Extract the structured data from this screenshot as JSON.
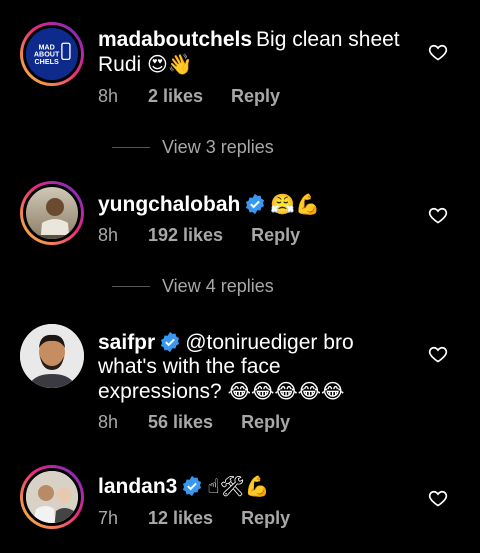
{
  "comments": [
    {
      "username": "madaboutchels",
      "verified": false,
      "mention": "",
      "text": "Big clean sheet Rudi",
      "emojis": "😍👋",
      "time": "8h",
      "likes": "2 likes",
      "reply": "Reply",
      "avatar_text": "MADABOUTCHELS"
    },
    {
      "username": "yungchalobah",
      "verified": true,
      "mention": "",
      "text": "",
      "emojis": "😤💪",
      "time": "8h",
      "likes": "192 likes",
      "reply": "Reply"
    },
    {
      "username": "saifpr",
      "verified": true,
      "mention": "@toniruediger",
      "text": "bro what's with the face expressions?",
      "emojis": "😂😂😂😂😂",
      "time": "8h",
      "likes": "56 likes",
      "reply": "Reply"
    },
    {
      "username": "landan3",
      "verified": true,
      "mention": "",
      "text": "",
      "emojis": "☝🛠💪",
      "time": "7h",
      "likes": "12 likes",
      "reply": "Reply"
    }
  ],
  "view_replies": [
    "View 3 replies",
    "View 4 replies"
  ],
  "colors": {
    "background": "#000000",
    "text": "#ffffff",
    "meta": "#a8a8a8",
    "verified": "#3897f0"
  }
}
